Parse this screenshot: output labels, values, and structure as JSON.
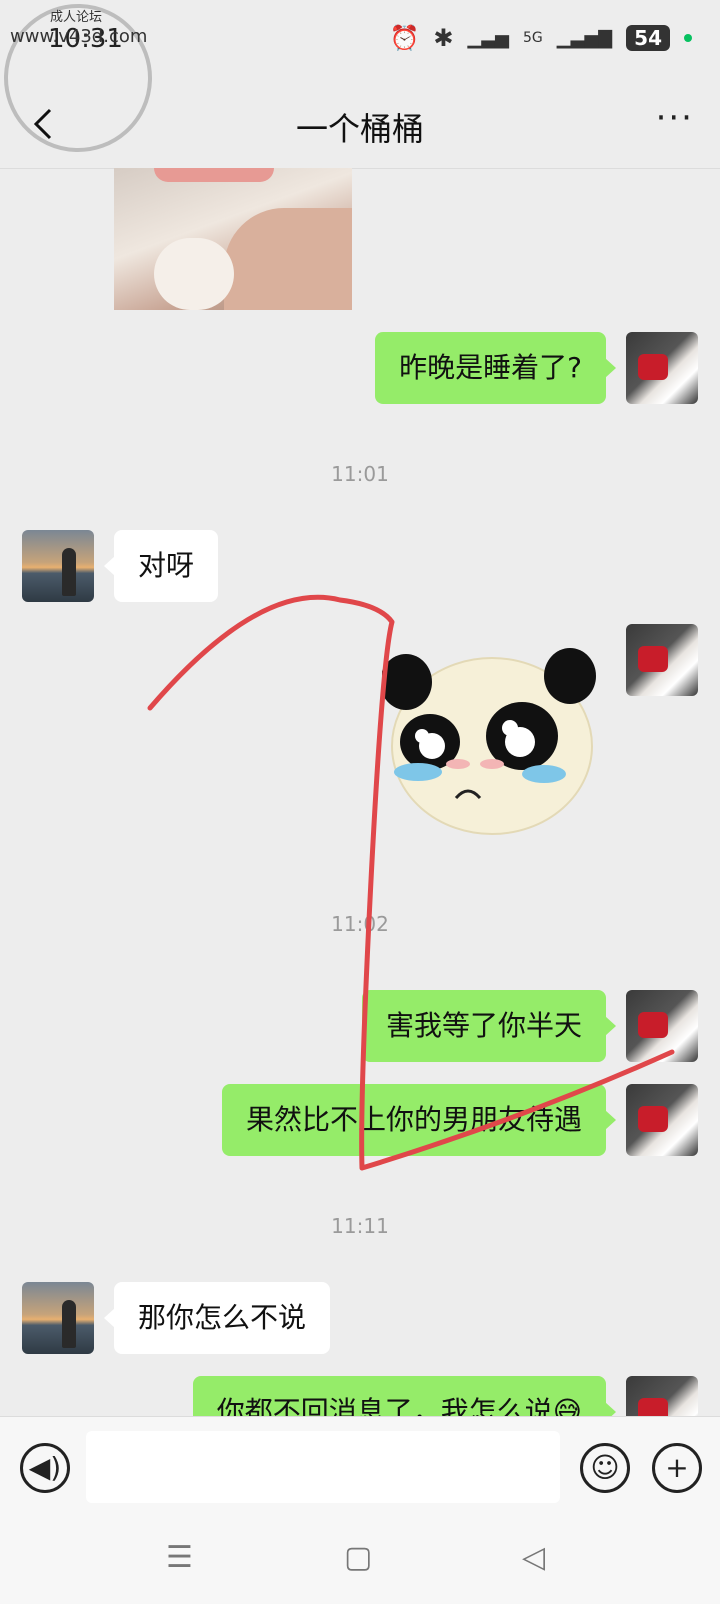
{
  "status_bar": {
    "time": "10:31",
    "network": "5G",
    "battery": "54"
  },
  "watermark": {
    "site": "www.v43d.com",
    "forum": "成人论坛"
  },
  "header": {
    "title": "一个桶桶",
    "more": "···"
  },
  "messages": [
    {
      "side": "right",
      "type": "text",
      "text": "昨晚是睡着了?"
    },
    {
      "type": "time",
      "text": "11:01"
    },
    {
      "side": "left",
      "type": "text",
      "text": "对呀"
    },
    {
      "side": "right",
      "type": "sticker",
      "sticker": "crying-panda"
    },
    {
      "type": "time",
      "text": "11:02"
    },
    {
      "side": "right",
      "type": "text",
      "text": "害我等了你半天"
    },
    {
      "side": "right",
      "type": "text",
      "text": "果然比不上你的男朋友待遇"
    },
    {
      "type": "time",
      "text": "11:11"
    },
    {
      "side": "left",
      "type": "text",
      "text": "那你怎么不说"
    },
    {
      "side": "right",
      "type": "text",
      "text": "你都不回消息了，我怎么说😅"
    }
  ],
  "composer": {
    "placeholder": "",
    "voice_icon": "voice-icon",
    "emoji_icon": "emoji-icon",
    "plus_icon": "plus-icon"
  },
  "nav": {
    "menu_icon": "menu-icon",
    "home_icon": "home-icon",
    "back_icon": "back-triangle-icon"
  },
  "annotation": {
    "color": "#e0474a"
  }
}
